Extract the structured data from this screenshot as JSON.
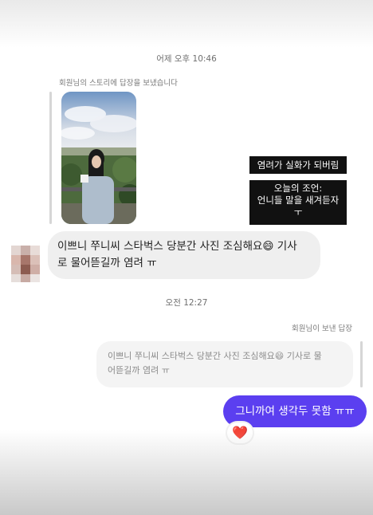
{
  "timestamps": {
    "first": "어제 오후 10:46",
    "second": "오전 12:27"
  },
  "story_reply": {
    "caption": "회원님의 스토리에 답장을 보냈습니다",
    "label_1": "염려가 실화가 되버림",
    "label_2_line1": "오늘의 조언:",
    "label_2_line2": "언니들 말을 새겨듣자",
    "label_2_line3": "ㅜ"
  },
  "incoming_message": {
    "line1": "이쁘니 쭈니씨 스타벅스 당분간 사진 조심해요😄 기사",
    "line2": "로 물어뜯길까 염려 ㅠ"
  },
  "my_reply": {
    "caption": "회원님이 보낸 답장",
    "quoted_line1": "이쁘니 쭈니씨 스타벅스 당분간 사진 조심해요😄 기사로 물",
    "quoted_line2": "어뜯길까 염려 ㅠ",
    "message": "그니까여 생각두 못함 ㅠㅠ",
    "reaction": "❤️"
  },
  "colors": {
    "sent_bubble": "#5b3ff0",
    "received_bubble": "#efefef",
    "story_label_bg": "#111111"
  },
  "icons": {
    "reaction": "heart-emoji"
  }
}
